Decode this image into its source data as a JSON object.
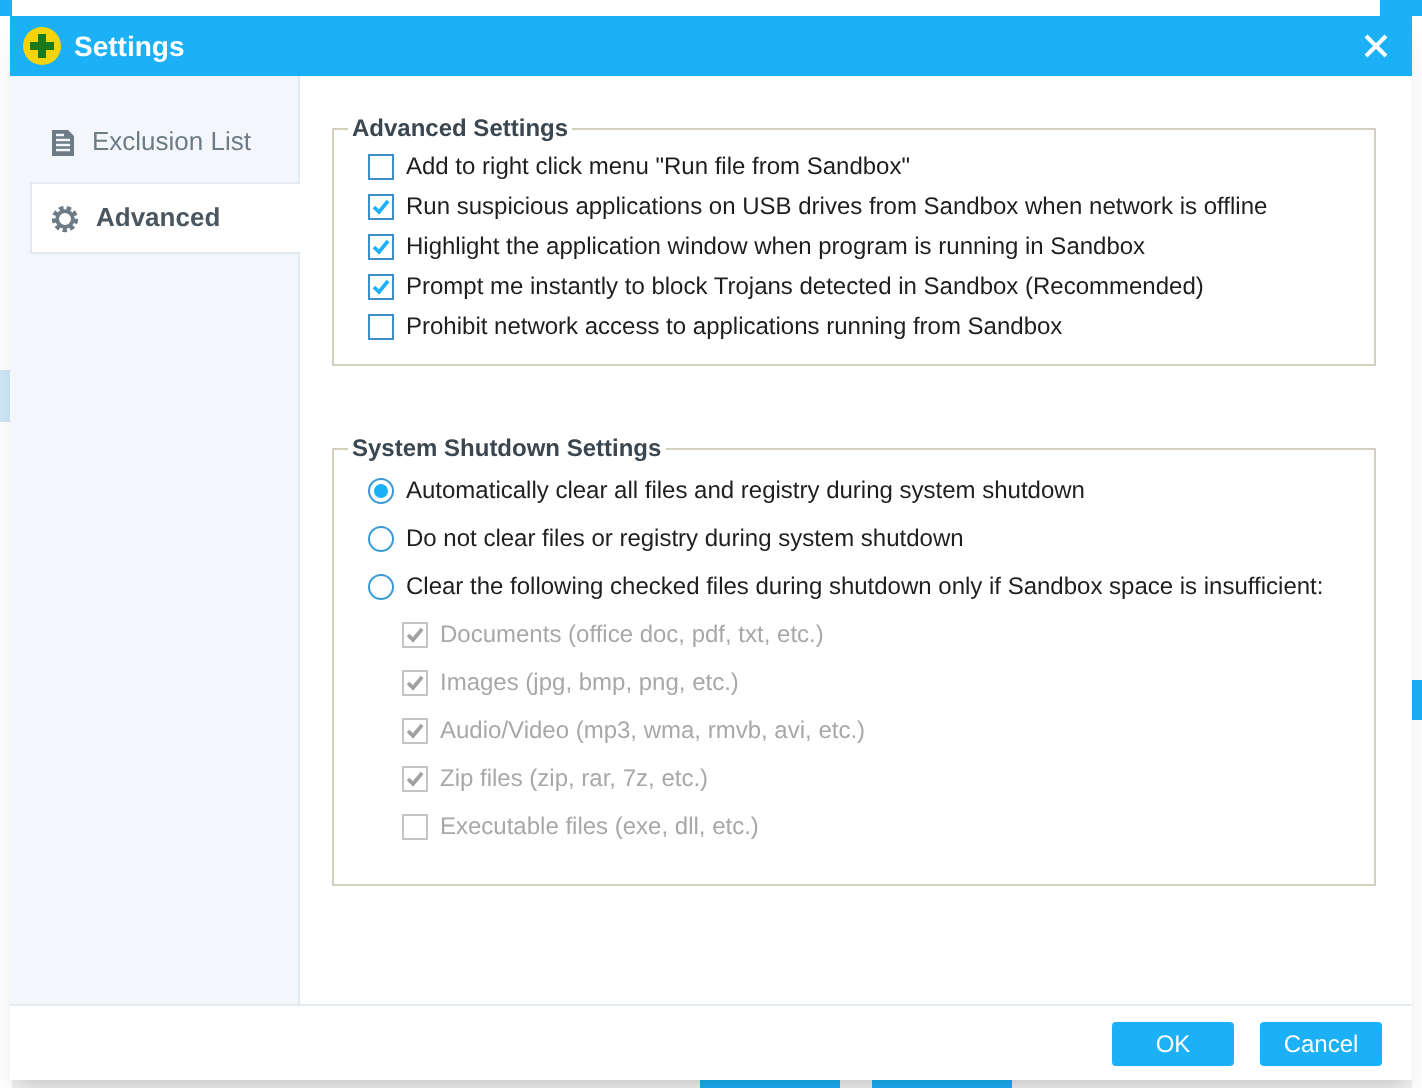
{
  "window": {
    "title": "Settings"
  },
  "sidebar": {
    "items": [
      {
        "label": "Exclusion List",
        "kind": "document",
        "selected": false
      },
      {
        "label": "Advanced",
        "kind": "gear",
        "selected": true
      }
    ]
  },
  "advanced_settings": {
    "title": "Advanced Settings",
    "options": [
      {
        "label": "Add to right click menu \"Run file from Sandbox\"",
        "checked": false
      },
      {
        "label": "Run suspicious applications on USB drives from Sandbox when network is offline",
        "checked": true
      },
      {
        "label": "Highlight the application window when program is running in Sandbox",
        "checked": true
      },
      {
        "label": "Prompt me instantly to block Trojans detected in Sandbox (Recommended)",
        "checked": true
      },
      {
        "label": "Prohibit network access to applications running from Sandbox",
        "checked": false
      }
    ]
  },
  "shutdown_settings": {
    "title": "System Shutdown Settings",
    "choices": [
      {
        "label": "Automatically clear all files and registry during system shutdown",
        "selected": true
      },
      {
        "label": "Do not clear files or registry during system shutdown",
        "selected": false
      },
      {
        "label": "Clear the following checked files during shutdown only if Sandbox space is insufficient:",
        "selected": false
      }
    ],
    "file_types": [
      {
        "label": "Documents (office doc, pdf, txt, etc.)",
        "checked": true,
        "disabled": true
      },
      {
        "label": "Images (jpg, bmp, png, etc.)",
        "checked": true,
        "disabled": true
      },
      {
        "label": "Audio/Video (mp3, wma, rmvb, avi, etc.)",
        "checked": true,
        "disabled": true
      },
      {
        "label": "Zip files (zip, rar, 7z, etc.)",
        "checked": true,
        "disabled": true
      },
      {
        "label": "Executable files (exe, dll, etc.)",
        "checked": false,
        "disabled": true
      }
    ]
  },
  "buttons": [
    "OK",
    "Cancel"
  ]
}
